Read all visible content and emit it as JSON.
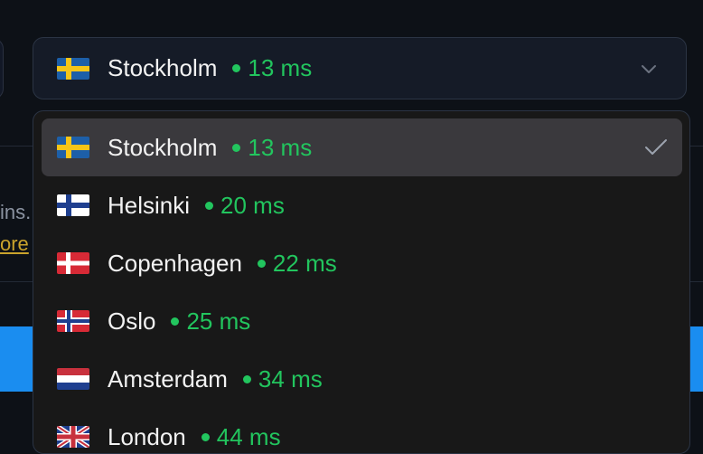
{
  "background": {
    "partial_text": "ins.",
    "partial_link": "ore"
  },
  "select": {
    "city": "Stockholm",
    "latency": "13 ms",
    "flag": "se-flag-icon"
  },
  "options": [
    {
      "city": "Stockholm",
      "latency": "13 ms",
      "flag": "se-flag-icon",
      "selected": true
    },
    {
      "city": "Helsinki",
      "latency": "20 ms",
      "flag": "fi-flag-icon",
      "selected": false
    },
    {
      "city": "Copenhagen",
      "latency": "22 ms",
      "flag": "dk-flag-icon",
      "selected": false
    },
    {
      "city": "Oslo",
      "latency": "25 ms",
      "flag": "no-flag-icon",
      "selected": false
    },
    {
      "city": "Amsterdam",
      "latency": "34 ms",
      "flag": "nl-flag-icon",
      "selected": false
    },
    {
      "city": "London",
      "latency": "44 ms",
      "flag": "gb-flag-icon",
      "selected": false
    }
  ],
  "colors": {
    "latency_green": "#22c55e",
    "selected_row": "#3a393d",
    "accent_blue": "#1a8df0"
  }
}
